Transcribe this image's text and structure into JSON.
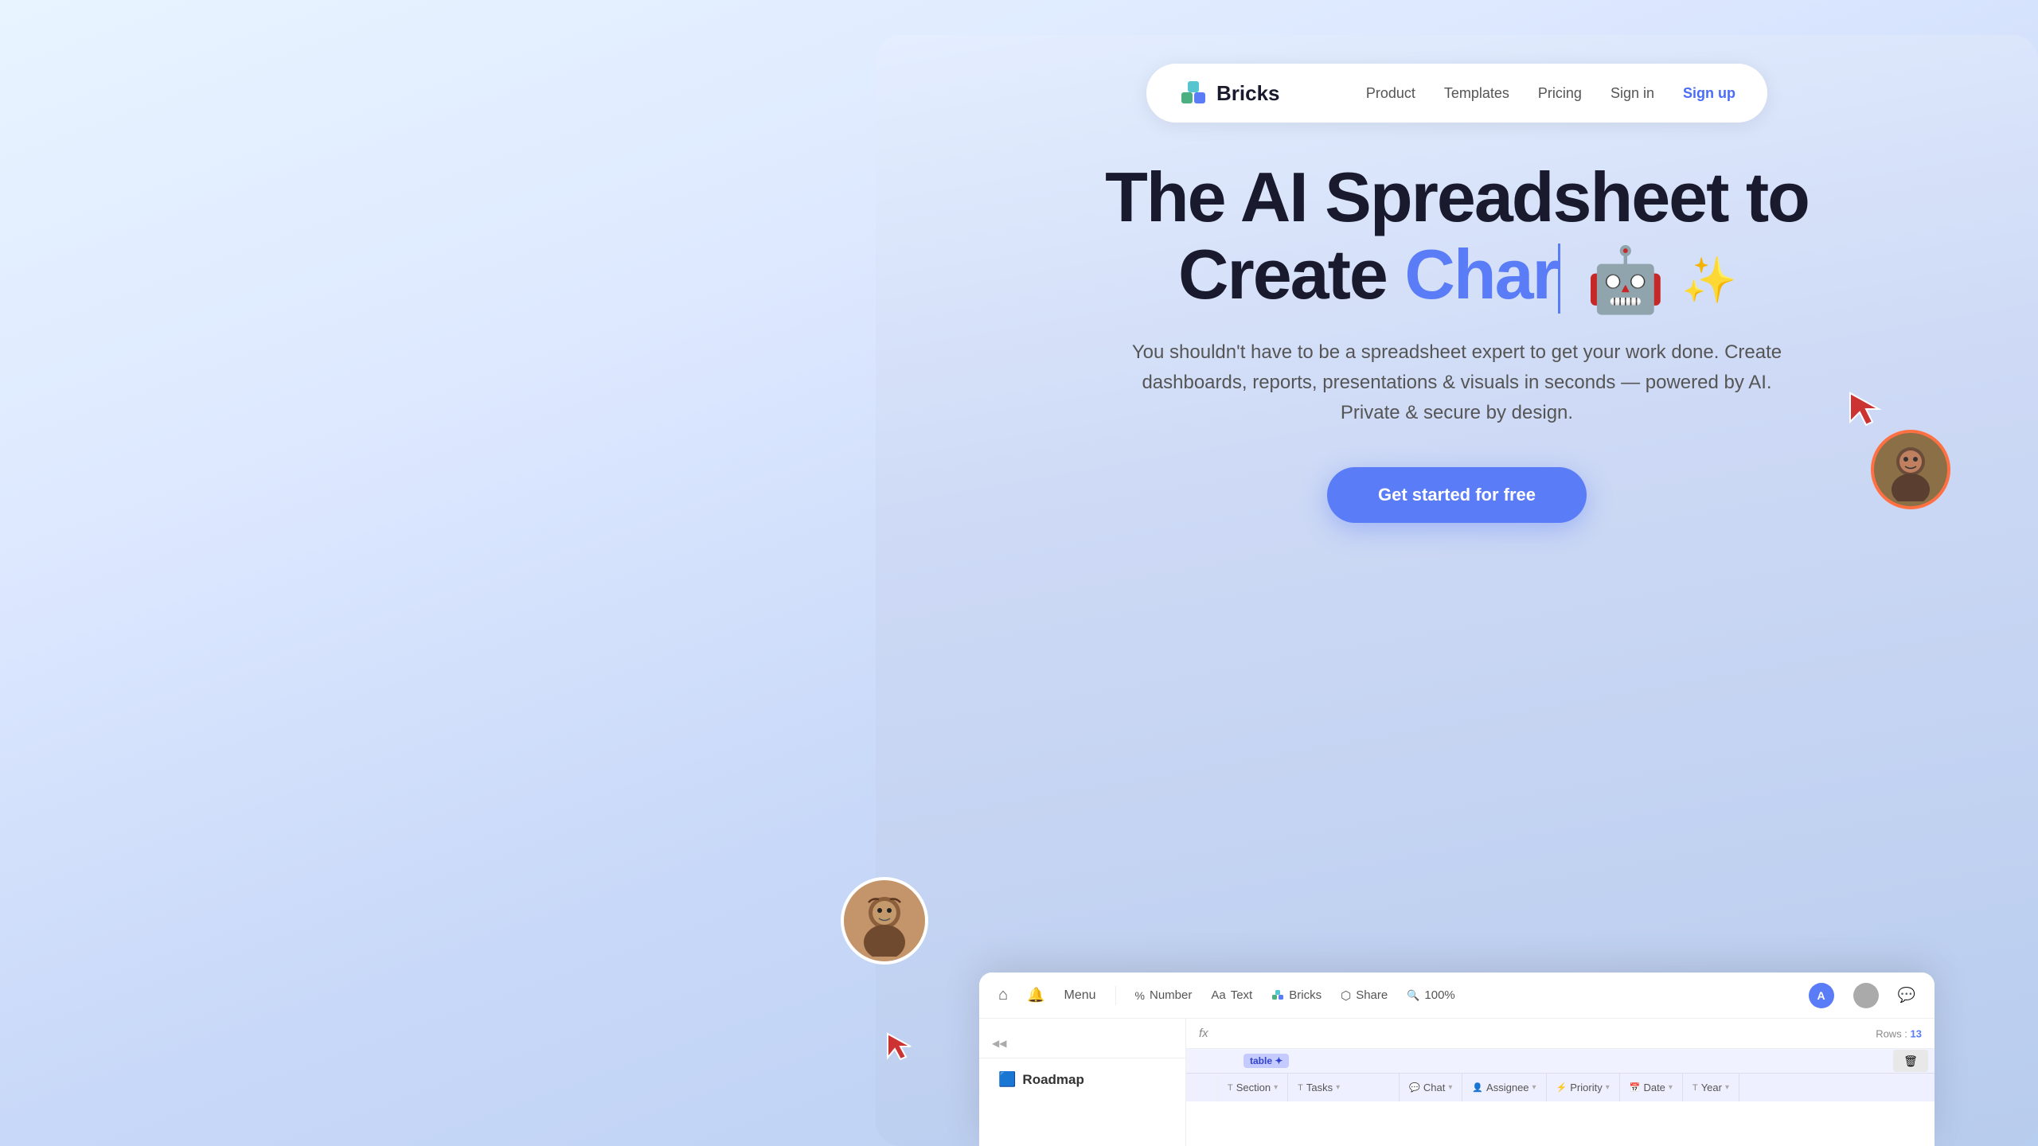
{
  "meta": {
    "title": "Bricks - The AI Spreadsheet"
  },
  "background": {
    "gradient_start": "#e8f4ff",
    "gradient_end": "#b8cef0"
  },
  "navbar": {
    "logo_text": "Bricks",
    "links": [
      {
        "id": "product",
        "label": "Product"
      },
      {
        "id": "templates",
        "label": "Templates"
      },
      {
        "id": "pricing",
        "label": "Pricing"
      },
      {
        "id": "signin",
        "label": "Sign in"
      },
      {
        "id": "signup",
        "label": "Sign up"
      }
    ]
  },
  "hero": {
    "title_line1": "The AI Spreadsheet to",
    "title_line2_prefix": "Create ",
    "title_line2_word": "Char",
    "subtitle": "You shouldn't have to be a spreadsheet expert to get your work done. Create dashboards, reports, presentations & visuals in seconds — powered by AI. Private & secure by design.",
    "cta_label": "Get started for free"
  },
  "app_preview": {
    "toolbar": {
      "menu_label": "Menu",
      "number_label": "Number",
      "text_label": "Text",
      "bricks_label": "Bricks",
      "share_label": "Share",
      "zoom_label": "100%",
      "rows_label": "Rows : ",
      "rows_count": "13"
    },
    "sidebar": {
      "file_name": "Roadmap"
    },
    "table": {
      "tag": "table ✦",
      "columns": [
        {
          "icon": "T",
          "label": "Section"
        },
        {
          "icon": "T",
          "label": "Tasks"
        },
        {
          "icon": "💬",
          "label": "Chat"
        },
        {
          "icon": "👤",
          "label": "Assignee"
        },
        {
          "icon": "⚡",
          "label": "Priority"
        },
        {
          "icon": "📅",
          "label": "Date"
        },
        {
          "icon": "T",
          "label": "Year"
        }
      ]
    }
  },
  "icons": {
    "home": "⌂",
    "bell": "🔔",
    "search": "🔍",
    "percent": "%",
    "text": "Aa",
    "share": "⬡",
    "zoom": "🔍",
    "chat": "💬",
    "fx": "fx",
    "collapse": "◀◀",
    "robot": "🤖",
    "sparkles": "✨"
  }
}
